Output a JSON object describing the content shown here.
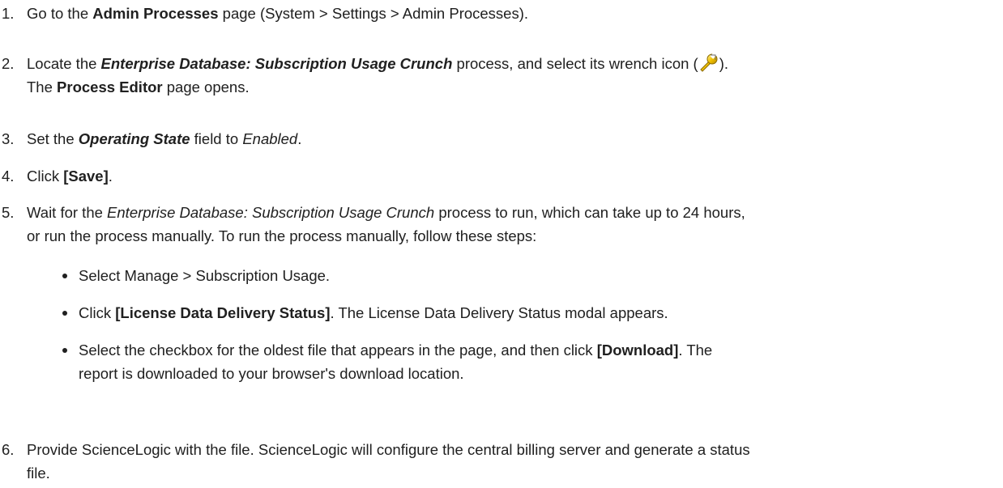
{
  "steps": [
    {
      "number": "1.",
      "p1": "Go to the ",
      "b1": "Admin Processes",
      "p2": " page (System > Settings > Admin Processes)."
    },
    {
      "number": "2.",
      "p1": "Locate the ",
      "bi1": "Enterprise Database: Subscription Usage Crunch",
      "p2": " process, and select its wrench icon (",
      "icon": "wrench-icon",
      "p3": ").",
      "p4": "The ",
      "b1": "Process Editor",
      "p5": " page opens."
    },
    {
      "number": "3.",
      "p1": "Set the ",
      "bi1": "Operating State",
      "p2": " field to ",
      "i1": "Enabled",
      "p3": "."
    },
    {
      "number": "4.",
      "p1": "Click ",
      "b1": "[Save]",
      "p2": "."
    },
    {
      "number": "5.",
      "p1": "Wait for the ",
      "i1": "Enterprise Database: Subscription Usage Crunch",
      "p2": " process to run, which can take up to 24 hours,",
      "p3": "or run the process manually. To run the process manually, follow these steps:",
      "bullets": [
        {
          "p1": "Select Manage > Subscription Usage."
        },
        {
          "p1": "Click ",
          "b1": "[License Data Delivery Status]",
          "p2": ". The License Data Delivery Status modal appears."
        },
        {
          "p1": "Select the checkbox for the oldest file that appears in the page, and then click ",
          "b1": "[Download]",
          "p2": ". The",
          "p3": "report is downloaded to your browser's download location."
        }
      ]
    },
    {
      "number": "6.",
      "p1": "Provide ScienceLogic with the file. ScienceLogic will configure the central billing server and generate a status",
      "p2": "file."
    }
  ]
}
